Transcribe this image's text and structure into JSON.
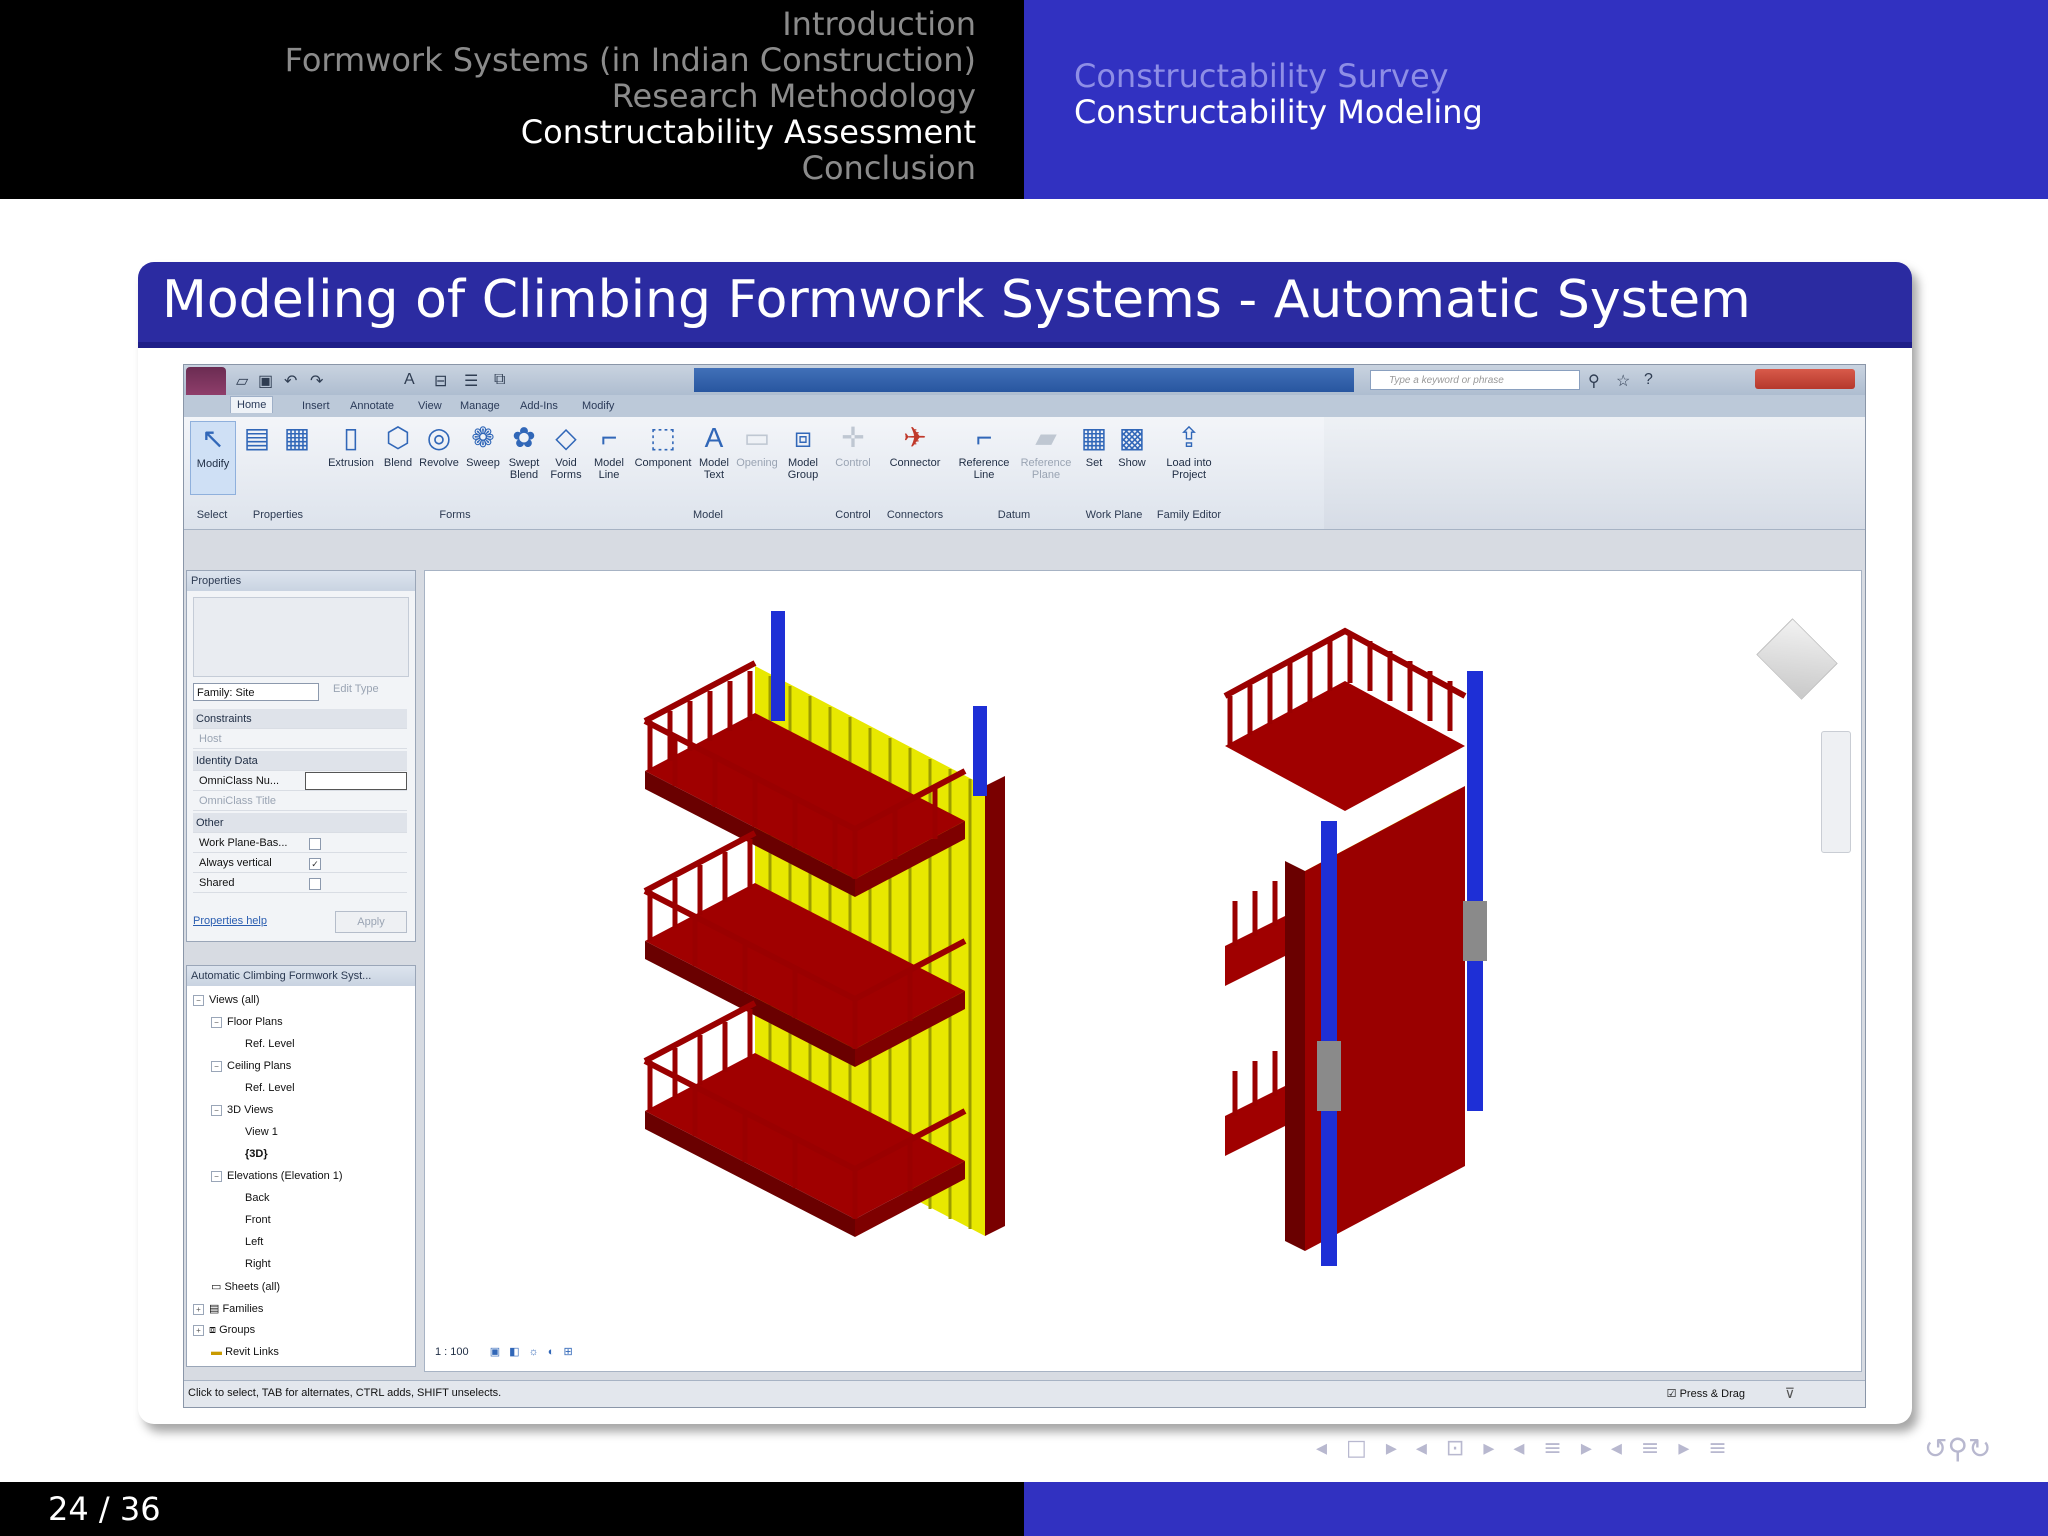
{
  "header": {
    "sections": [
      {
        "label": "Introduction",
        "active": false
      },
      {
        "label": "Formwork Systems (in Indian Construction)",
        "active": false
      },
      {
        "label": "Research Methodology",
        "active": false
      },
      {
        "label": "Constructability Assessment",
        "active": true
      },
      {
        "label": "Conclusion",
        "active": false
      }
    ],
    "subsections": [
      {
        "label": "Constructability Survey",
        "active": false
      },
      {
        "label": "Constructability Modeling",
        "active": true
      }
    ]
  },
  "frame": {
    "title": "Modeling of Climbing Formwork Systems - Automatic System"
  },
  "revit": {
    "search_placeholder": "Type a keyword or phrase",
    "tabs": [
      "Home",
      "Insert",
      "Annotate",
      "View",
      "Manage",
      "Add-Ins",
      "Modify"
    ],
    "ribbon_buttons": {
      "modify": "Modify",
      "extrusion": "Extrusion",
      "blend": "Blend",
      "revolve": "Revolve",
      "sweep": "Sweep",
      "swept_blend": "Swept Blend",
      "void_forms": "Void Forms",
      "model_line": "Model Line",
      "component": "Component",
      "model_text": "Model Text",
      "opening": "Opening",
      "model_group": "Model Group",
      "control": "Control",
      "connector": "Connector",
      "reference_line": "Reference Line",
      "reference_plane": "Reference Plane",
      "set": "Set",
      "show": "Show",
      "load_into_project": "Load into Project"
    },
    "ribbon_groups": {
      "select": "Select",
      "properties": "Properties",
      "forms": "Forms",
      "model": "Model",
      "control": "Control",
      "connectors": "Connectors",
      "datum": "Datum",
      "work_plane": "Work Plane",
      "family_editor": "Family Editor"
    },
    "properties": {
      "title": "Properties",
      "family_select": "Family: Site",
      "edit_type": "Edit Type",
      "rows": {
        "constraints": "Constraints",
        "host": "Host",
        "identity_data": "Identity Data",
        "omniclass_number": "OmniClass Nu...",
        "omniclass_title": "OmniClass Title",
        "other": "Other",
        "work_plane_based": "Work Plane-Bas...",
        "always_vertical": "Always vertical",
        "shared": "Shared"
      },
      "help_link": "Properties help",
      "apply": "Apply"
    },
    "browser": {
      "title": "Automatic Climbing Formwork Syst...",
      "items": {
        "views": "Views (all)",
        "floor_plans": "Floor Plans",
        "fp_ref_level": "Ref. Level",
        "ceiling_plans": "Ceiling Plans",
        "cp_ref_level": "Ref. Level",
        "views_3d": "3D Views",
        "view1": "View 1",
        "view_3d": "{3D}",
        "elevations": "Elevations (Elevation 1)",
        "back": "Back",
        "front": "Front",
        "left": "Left",
        "right": "Right",
        "sheets": "Sheets (all)",
        "families": "Families",
        "groups": "Groups",
        "revit_links": "Revit Links"
      }
    },
    "view_scale": "1 : 100",
    "status_text": "Click to select, TAB for alternates, CTRL adds, SHIFT unselects.",
    "press_drag": "Press & Drag"
  },
  "footer": {
    "page": "24 / 36"
  },
  "colors": {
    "beamer_blue": "#3131c1",
    "frame_title_blue": "#2b2ba1",
    "formwork_red": "#a00000",
    "formwork_yellow": "#f2f200",
    "climbing_blue": "#1e2fd6"
  }
}
